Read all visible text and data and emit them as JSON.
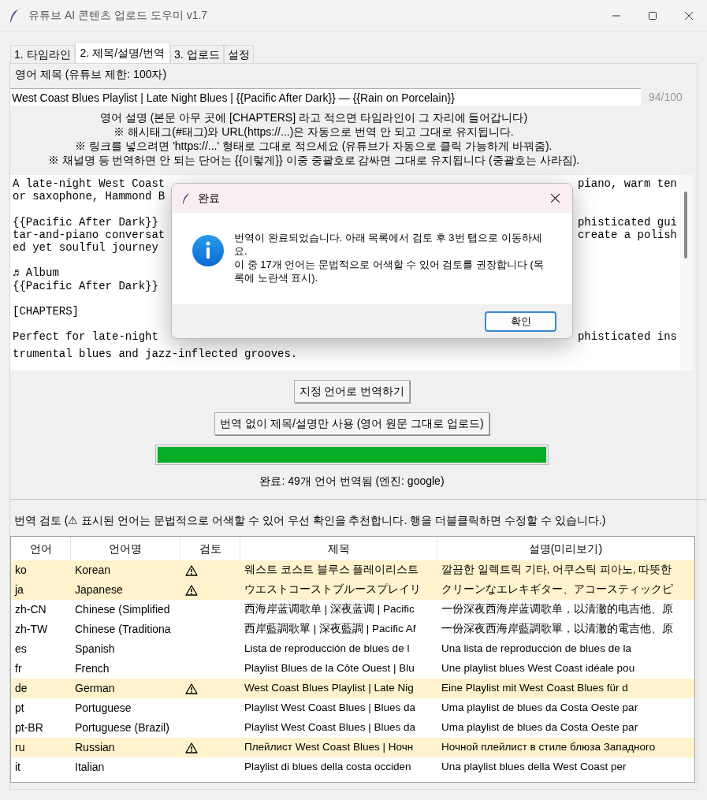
{
  "window": {
    "title": "유튜브 AI 콘텐츠 업로드 도우미 v1.7"
  },
  "tabs": [
    {
      "label": "1. 타임라인",
      "selected": false
    },
    {
      "label": "2. 제목/설명/번역",
      "selected": true
    },
    {
      "label": "3. 업로드",
      "selected": false
    },
    {
      "label": "설정",
      "selected": false
    }
  ],
  "title_section": {
    "label": "영어 제목 (유튜브 제한: 100자)",
    "value": "West Coast Blues Playlist | Late Night Blues | {{Pacific After Dark}} — {{Rain on Porcelain}}",
    "counter": "94/100"
  },
  "description_notes": [
    "영어 설명 (본문 아무 곳에 [CHAPTERS] 라고 적으면 타임라인이 그 자리에 들어갑니다)",
    "※ 해시태그(#태그)와 URL(https://...)은 자동으로 번역 안 되고 그대로 유지됩니다.",
    "※ 링크를 넣으려면 'https://...' 형태로 그대로 적으세요 (유튜브가 자동으로 클릭 가능하게 바꿔줌).",
    "※ 채널명 등 번역하면 안 되는 단어는 {{이렇게}} 이중 중괄호로 감싸면 그대로 유지됩니다 (중괄호는 사라짐)."
  ],
  "description_lines": [
    {
      "kind": "text",
      "left": "A late-night West Coast",
      "right": "piano, warm ten"
    },
    {
      "kind": "text",
      "left": "or saxophone, Hammond B"
    },
    {
      "kind": "blank"
    },
    {
      "kind": "text",
      "left": "{{Pacific After Dark}}",
      "right": "phisticated gui"
    },
    {
      "kind": "text",
      "left": "tar-and-piano conversat",
      "right": "create a polish"
    },
    {
      "kind": "text",
      "left": "ed yet soulful journey"
    },
    {
      "kind": "blank"
    },
    {
      "kind": "text",
      "left": "♬ Album"
    },
    {
      "kind": "text",
      "left": "{{Pacific After Dark}}"
    },
    {
      "kind": "blank"
    },
    {
      "kind": "text",
      "left": "[CHAPTERS]"
    },
    {
      "kind": "blank"
    },
    {
      "kind": "text",
      "left": "Perfect for late-night",
      "right": "phisticated ins"
    },
    {
      "kind": "text",
      "left": "trumental blues and jazz-inflected grooves."
    }
  ],
  "buttons": [
    "지정 언어로 번역하기",
    "번역 없이 제목/설명만 사용 (영어 원문 그대로 업로드)"
  ],
  "progress": {
    "level": 1,
    "status": "완료: 49개 언어 번역됨 (엔진: google)"
  },
  "review": {
    "label": "번역 검토 (⚠ 표시된 언어는 문법적으로 어색할 수 있어 우선 확인을 추천합니다. 행을 더블클릭하면 수정할 수 있습니다.)",
    "columns": [
      "언어",
      "언어명",
      "검토",
      "제목",
      "설명(미리보기)"
    ],
    "rows": [
      {
        "code": "ko",
        "name": "Korean",
        "flagged": true,
        "title": "웨스트 코스트 블루스 플레이리스트",
        "description": "깔끔한 일렉트릭 기타, 어쿠스틱 피아노, 따뜻한"
      },
      {
        "code": "ja",
        "name": "Japanese",
        "flagged": true,
        "title": "ウエストコーストブルースプレイリ",
        "description": "クリーンなエレキギター、アコースティックピ"
      },
      {
        "code": "zh-CN",
        "name": "Chinese (Simplified",
        "flagged": false,
        "title": "西海岸蓝调歌单 | 深夜蓝调 | Pacific",
        "description": "一份深夜西海岸蓝调歌单，以清澈的电吉他、原"
      },
      {
        "code": "zh-TW",
        "name": "Chinese (Traditiona",
        "flagged": false,
        "title": "西岸藍調歌單 | 深夜藍調 | Pacific Af",
        "description": "一份深夜西海岸藍調歌單，以清澈的電吉他、原"
      },
      {
        "code": "es",
        "name": "Spanish",
        "flagged": false,
        "title": "Lista de reproducción de blues de l",
        "description": "Una lista de reproducción de blues de la"
      },
      {
        "code": "fr",
        "name": "French",
        "flagged": false,
        "title": "Playlist Blues de la Côte Ouest | Blu",
        "description": "Une playlist blues West Coast idéale pou"
      },
      {
        "code": "de",
        "name": "German",
        "flagged": true,
        "title": "West Coast Blues Playlist | Late Nig",
        "description": "Eine Playlist mit West Coast Blues für d"
      },
      {
        "code": "pt",
        "name": "Portuguese",
        "flagged": false,
        "title": "Playlist West Coast Blues | Blues da",
        "description": "Uma playlist de blues da Costa Oeste par"
      },
      {
        "code": "pt-BR",
        "name": "Portuguese (Brazil)",
        "flagged": false,
        "title": "Playlist West Coast Blues | Blues da",
        "description": "Uma playlist de blues da Costa Oeste par"
      },
      {
        "code": "ru",
        "name": "Russian",
        "flagged": true,
        "title": "Плейлист West Coast Blues | Ночн",
        "description": "Ночной плейлист в стиле блюза Западного"
      },
      {
        "code": "it",
        "name": "Italian",
        "flagged": false,
        "title": "Playlist di blues della costa occiden",
        "description": "Una playlist blues della West Coast per"
      }
    ]
  },
  "dialog": {
    "title": "완료",
    "message": "번역이 완료되었습니다. 아래 목록에서 검토 후 3번 탭으로 이동하세요.\n이 중 17개 언어는 문법적으로 어색할 수 있어 검토를 권장합니다 (목록에 노란색 표시).",
    "button": "확인"
  }
}
